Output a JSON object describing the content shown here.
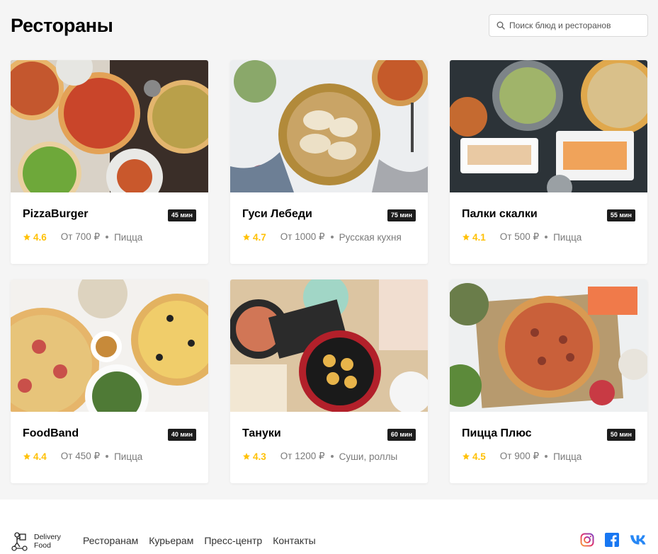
{
  "header": {
    "title": "Рестораны",
    "search_placeholder": "Поиск блюд и ресторанов"
  },
  "restaurants": [
    {
      "name": "PizzaBurger",
      "time": "45 мин",
      "rating": "4.6",
      "price": "От 700 ₽",
      "cuisine": "Пицца"
    },
    {
      "name": "Гуси Лебеди",
      "time": "75 мин",
      "rating": "4.7",
      "price": "От 1000 ₽",
      "cuisine": "Русская кухня"
    },
    {
      "name": "Палки скалки",
      "time": "55 мин",
      "rating": "4.1",
      "price": "От 500 ₽",
      "cuisine": "Пицца"
    },
    {
      "name": "FoodBand",
      "time": "40 мин",
      "rating": "4.4",
      "price": "От 450 ₽",
      "cuisine": "Пицца"
    },
    {
      "name": "Тануки",
      "time": "60 мин",
      "rating": "4.3",
      "price": "От 1200 ₽",
      "cuisine": "Суши, роллы"
    },
    {
      "name": "Пицца Плюс",
      "time": "50 мин",
      "rating": "4.5",
      "price": "От 900 ₽",
      "cuisine": "Пицца"
    }
  ],
  "footer": {
    "logo_line1": "Delivery",
    "logo_line2": "Food",
    "nav": [
      "Ресторанам",
      "Курьерам",
      "Пресс-центр",
      "Контакты"
    ],
    "social_icons": [
      "instagram-icon",
      "facebook-icon",
      "vk-icon"
    ]
  },
  "colors": {
    "accent_star": "#ffc107",
    "badge_bg": "#1c1c1c",
    "page_bg": "#f5f5f5",
    "facebook": "#1877f2",
    "vk": "#2787f5"
  }
}
